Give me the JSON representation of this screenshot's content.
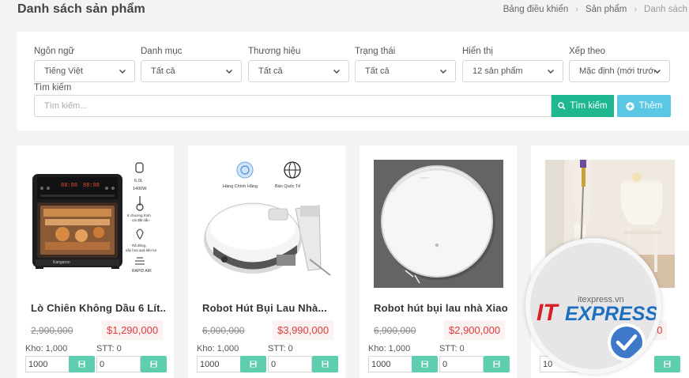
{
  "header": {
    "title": "Danh sách sản phẩm",
    "breadcrumb": [
      "Bảng điều khiển",
      "Sản phẩm",
      "Danh sách"
    ]
  },
  "filters": [
    {
      "label": "Ngôn ngữ",
      "value": "Tiếng Việt"
    },
    {
      "label": "Danh mục",
      "value": "Tất cả"
    },
    {
      "label": "Thương hiệu",
      "value": "Tất cả"
    },
    {
      "label": "Trạng thái",
      "value": "Tất cả"
    },
    {
      "label": "Hiển thị",
      "value": "12 sản phẩm"
    },
    {
      "label": "Xếp theo",
      "value": "Mặc định (mới trước)"
    }
  ],
  "search": {
    "label": "Tìm kiếm",
    "placeholder": "Tìm kiếm...",
    "button_label": "Tìm kiếm",
    "add_label": "Thêm"
  },
  "products": [
    {
      "name": "Lò Chiên Không Dầu 6 Lít...",
      "price_old": "2,900,000",
      "price_new": "$1,290,000",
      "stock_label": "Kho: 1,000",
      "stt_label": "STT: 0",
      "stock_value": "1000",
      "stt_value": "0",
      "image_texts": {
        "capacity": "6.0L",
        "power": "1400W",
        "programs": "8 chương trình cài đặt sẵn",
        "rotate": "Rã đông, sấy hoa quả tiện lợi",
        "rapid": "RAPID AIR",
        "brand": "Kangaroo",
        "display": "88:88"
      }
    },
    {
      "name": "Robot Hút Bụi Lau Nhà...",
      "price_old": "6,000,000",
      "price_new": "$3,990,000",
      "stock_label": "Kho: 1,000",
      "stt_label": "STT: 0",
      "stock_value": "1000",
      "stt_value": "0",
      "image_texts": {
        "badge_left": "Hàng Chính Hãng",
        "badge_right": "Bản Quốc Tế"
      }
    },
    {
      "name": "Robot hút bụi lau nhà Xiao...",
      "price_old": "6,900,000",
      "price_new": "$2,900,000",
      "stock_label": "Kho: 1,000",
      "stt_label": "STT: 0",
      "stock_value": "1000",
      "stt_value": "0"
    },
    {
      "name": "",
      "price_old": "",
      "price_new": "50",
      "stock_label": "",
      "stt_label": "",
      "stock_value": "10",
      "stt_value": ""
    }
  ],
  "watermark": {
    "domain": "itexpress.vn",
    "brand_it": "IT",
    "brand_express": "EXPRESS"
  },
  "colors": {
    "search_button": "#1fb78f",
    "add_button": "#5ac8e5",
    "save_button": "#5ecdb0",
    "price_new": "#e03a3a"
  }
}
